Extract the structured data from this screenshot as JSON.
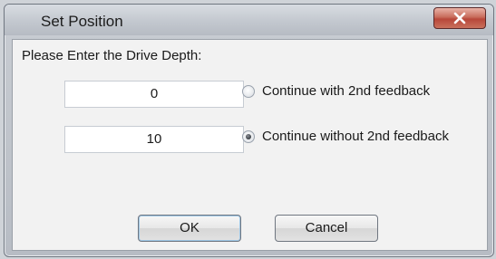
{
  "window": {
    "title": "Set Position"
  },
  "form": {
    "prompt": "Please Enter the Drive Depth:",
    "fields": [
      {
        "value": "0"
      },
      {
        "value": "10"
      }
    ],
    "options": [
      {
        "label": "Continue with 2nd feedback",
        "checked": false
      },
      {
        "label": "Continue without 2nd feedback",
        "checked": true
      }
    ]
  },
  "buttons": {
    "ok": "OK",
    "cancel": "Cancel"
  },
  "colors": {
    "close_button": "#c0392b",
    "window_frame": "#b7bcc4"
  }
}
